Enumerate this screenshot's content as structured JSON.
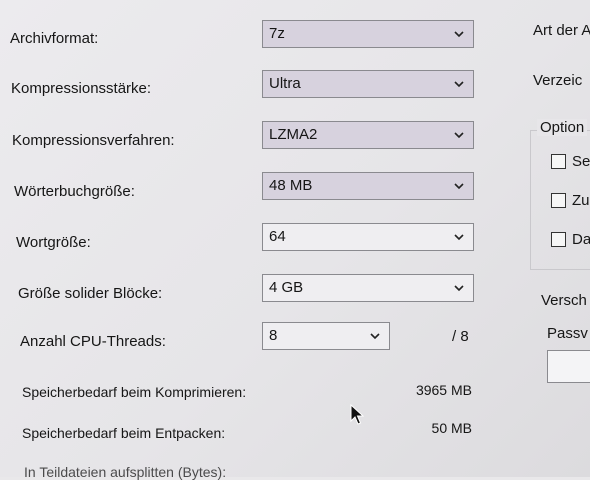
{
  "labels": {
    "archive_format": "Archivformat:",
    "compression_level": "Kompressionsstärke:",
    "compression_method": "Kompressionsverfahren:",
    "dictionary_size": "Wörterbuchgröße:",
    "word_size": "Wortgröße:",
    "solid_block_size": "Größe solider Blöcke:",
    "cpu_threads": "Anzahl CPU-Threads:",
    "memory_compress": "Speicherbedarf beim Komprimieren:",
    "memory_decompress": "Speicherbedarf beim Entpacken:",
    "split_volumes": "In Teildateien aufsplitten (Bytes):"
  },
  "values": {
    "archive_format": "7z",
    "compression_level": "Ultra",
    "compression_method": "LZMA2",
    "dictionary_size": "48 MB",
    "word_size": "64",
    "solid_block_size": "4 GB",
    "cpu_threads": "8",
    "cpu_threads_max": "/ 8",
    "memory_compress": "3965 MB",
    "memory_decompress": "50 MB"
  },
  "right_panel": {
    "update_mode_label": "Art der A",
    "path_mode_label": "Verzeic",
    "options_title": "Option",
    "options": [
      "Se",
      "Zu",
      "Da"
    ],
    "encryption_label": "Versch",
    "password_label": "Passv"
  },
  "icons": {
    "dropdown": "chevron-down-icon",
    "pointer": "mouse-cursor-icon"
  }
}
